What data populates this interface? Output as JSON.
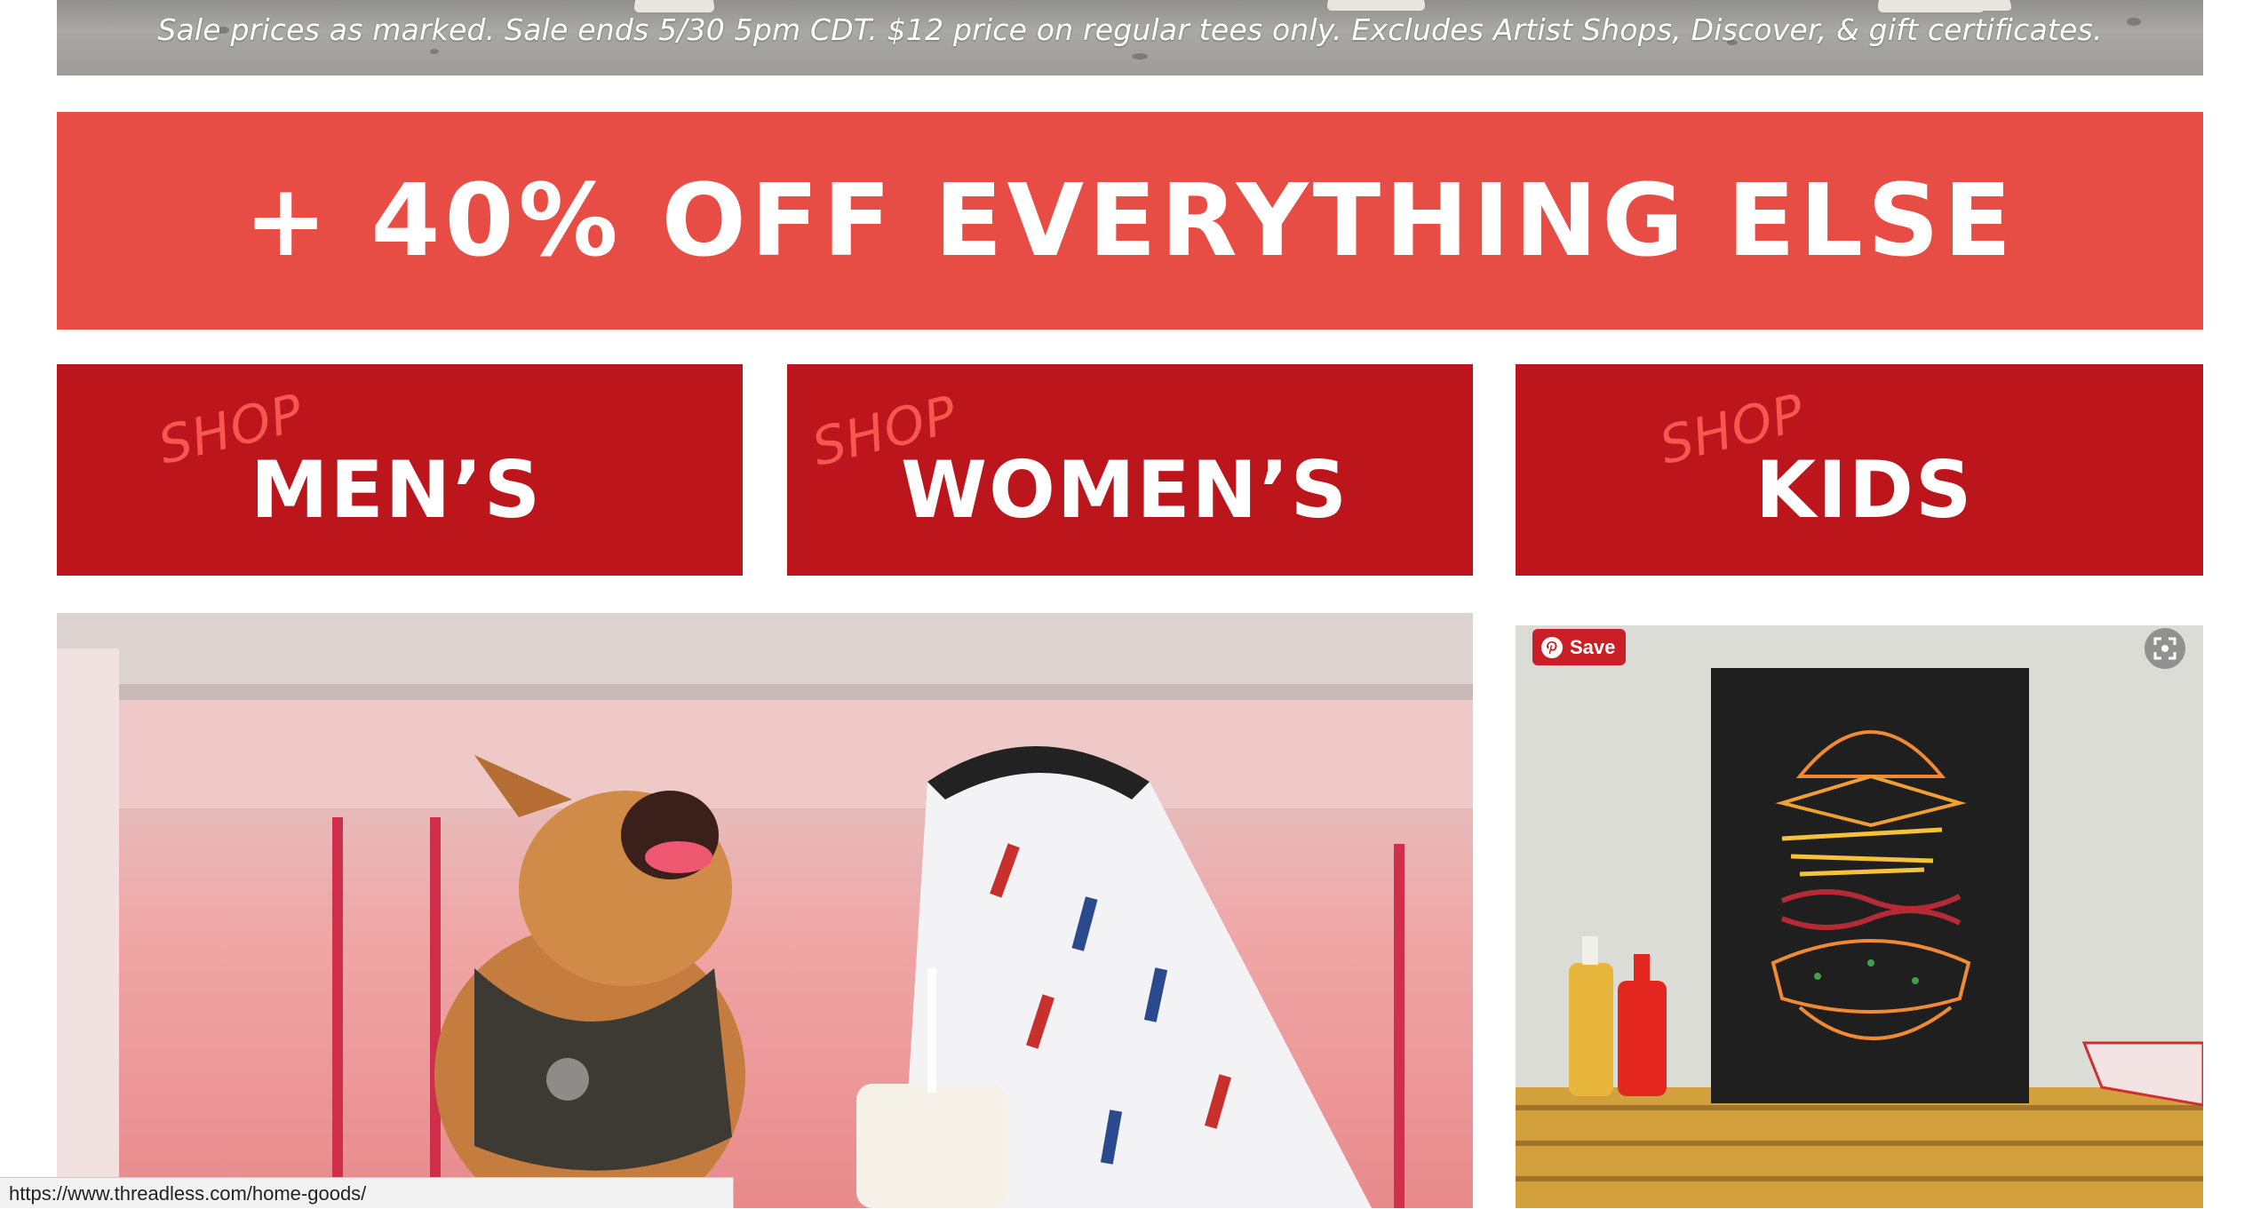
{
  "hero": {
    "fine_print": "Sale prices as marked. Sale ends 5/30 5pm CDT. $12 price on regular tees only. Excludes Artist Shops, Discover, & gift certificates."
  },
  "promo": {
    "text": "+ 40% OFF EVERYTHING ELSE",
    "color": "#e84d45"
  },
  "shop_tiles": [
    {
      "shop_label": "SHOP",
      "dept_label": "MEN’S"
    },
    {
      "shop_label": "SHOP",
      "dept_label": "WOMEN’S"
    },
    {
      "shop_label": "SHOP",
      "dept_label": "KIDS"
    }
  ],
  "tile_color": "#bd151c",
  "pinterest": {
    "save_label": "Save",
    "icon": "pinterest-icon"
  },
  "expand": {
    "icon": "expand-icon"
  },
  "status_bar": {
    "url": "https://www.threadless.com/home-goods/"
  }
}
